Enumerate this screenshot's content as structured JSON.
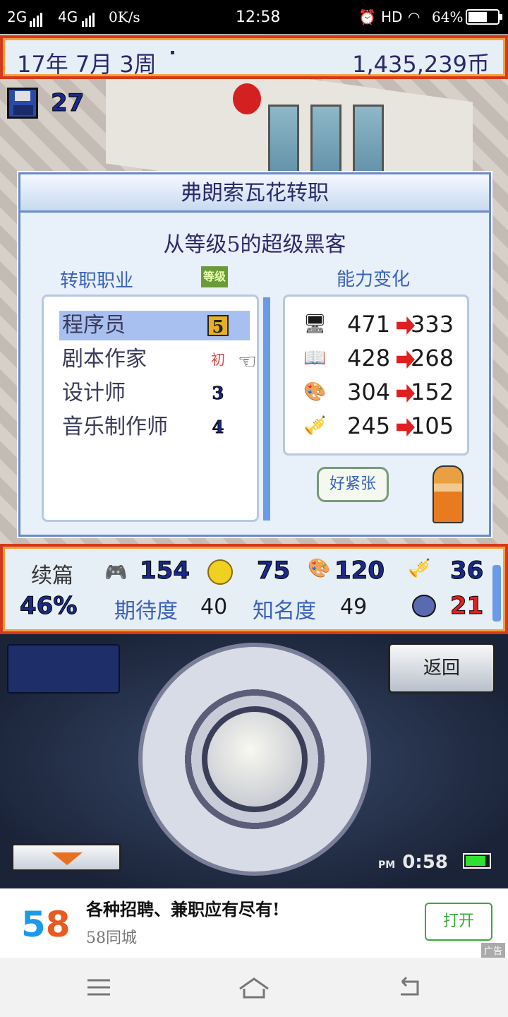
{
  "status_bar": {
    "net1": "2G",
    "net2": "4G",
    "speed": "0K/s",
    "time": "12:58",
    "hd": "HD",
    "battery": "64%"
  },
  "top_bar": {
    "date": "17年 7月 3周",
    "coins": "1,435,239币"
  },
  "save_count": "27",
  "dialog": {
    "title": "弗朗索瓦花转职",
    "subtitle": "从等级5的超级黑客",
    "col_job": "转职职业",
    "col_level": "等级",
    "col_ability": "能力变化",
    "jobs": [
      {
        "name": "程序员",
        "level": "5",
        "selected": true
      },
      {
        "name": "剧本作家",
        "level": "初",
        "selected": false
      },
      {
        "name": "设计师",
        "level": "3",
        "selected": false
      },
      {
        "name": "音乐制作师",
        "level": "4",
        "selected": false
      }
    ],
    "abilities": [
      {
        "icon": "computer-icon",
        "old": "471",
        "new": "333"
      },
      {
        "icon": "book-icon",
        "old": "428",
        "new": "268"
      },
      {
        "icon": "paint-icon",
        "old": "304",
        "new": "152"
      },
      {
        "icon": "trumpet-icon",
        "old": "245",
        "new": "105"
      }
    ],
    "speech": "好紧张"
  },
  "stats": {
    "sequel_label": "续篇",
    "sequel_pct": "46%",
    "fun": "154",
    "creativity": "75",
    "graphics": "120",
    "sound": "36",
    "expect_label": "期待度",
    "expect": "40",
    "fame_label": "知名度",
    "fame": "49",
    "bugs": "21"
  },
  "controller": {
    "back_label": "返回",
    "ampm": "PM",
    "clock": "0:58"
  },
  "ad": {
    "logo_a": "5",
    "logo_b": "8",
    "title": "各种招聘、兼职应有尽有!",
    "source": "58同城",
    "open_label": "打开",
    "tag": "广告"
  }
}
